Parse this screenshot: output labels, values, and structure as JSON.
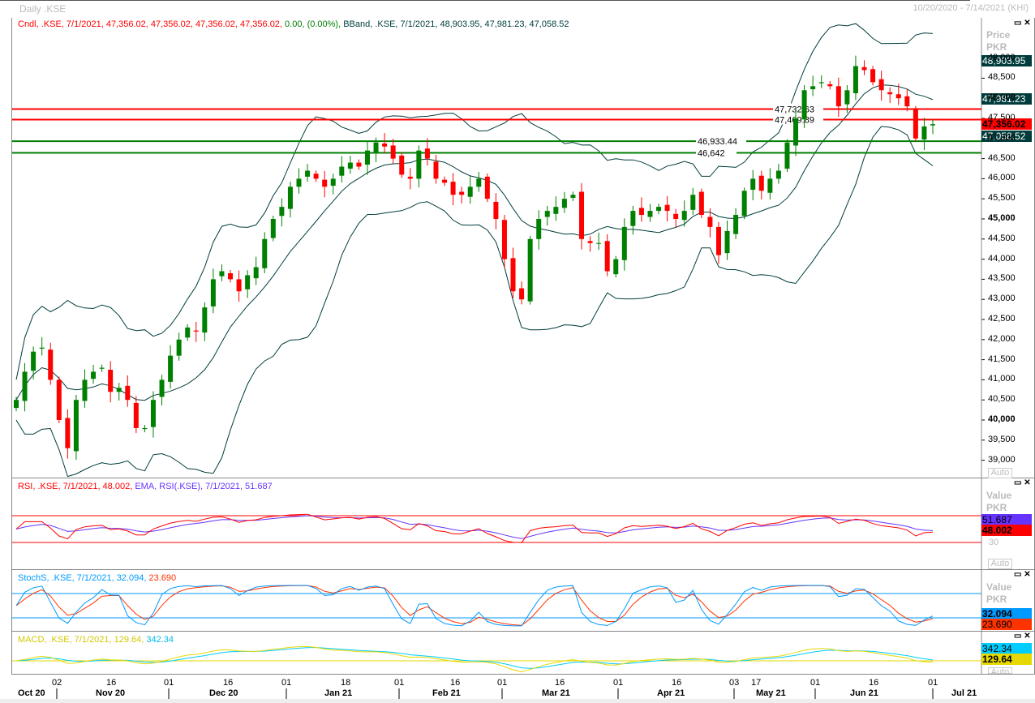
{
  "window": {
    "title": "Daily .KSE",
    "date_range": "10/20/2020 - 7/14/2021 (KHI)"
  },
  "legends": {
    "price_cndl": "Cndl, .KSE, 7/1/2021, 47,356.02, 47,356.02, 47,356.02, 47,356.02,",
    "price_chg": "0.00, (0.00%),",
    "price_bband": "BBand, .KSE, 7/1/2021, 48,903.95, 47,981.23, 47,058.52",
    "rsi": "RSI, .KSE, 7/1/2021, 48.002,",
    "rsi_ema": "EMA, RSI(.KSE), 7/1/2021, 51.687",
    "stoch_a": "StochS, .KSE, 7/1/2021, 32.094,",
    "stoch_b": "23.690",
    "macd_a": "MACD, .KSE, 7/1/2021, 129.64,",
    "macd_b": "342.34"
  },
  "axes": {
    "price_unit_1": "Price",
    "price_unit_2": "PKR",
    "value_unit_1": "Value",
    "value_unit_2": "PKR",
    "auto_label": "Auto",
    "rsi_tick": "30",
    "price_ticks": [
      "49,000",
      "48,500",
      "48,000",
      "47,500",
      "47,000",
      "46,500",
      "46,000",
      "45,500",
      "45,000",
      "44,500",
      "44,000",
      "43,500",
      "43,000",
      "42,500",
      "42,000",
      "41,500",
      "41,000",
      "40,500",
      "40,000",
      "39,500",
      "39,000"
    ],
    "x_days": [
      {
        "label": "02"
      },
      {
        "label": "16"
      },
      {
        "label": "01"
      },
      {
        "label": "16"
      },
      {
        "label": "01"
      },
      {
        "label": "18"
      },
      {
        "label": "01"
      },
      {
        "label": "16"
      },
      {
        "label": "01"
      },
      {
        "label": "16"
      },
      {
        "label": "01"
      },
      {
        "label": "16"
      },
      {
        "label": "03"
      },
      {
        "label": "17"
      },
      {
        "label": "01"
      },
      {
        "label": "16"
      },
      {
        "label": "01"
      }
    ],
    "x_months": [
      "Oct 20",
      "Nov 20",
      "Dec 20",
      "Jan 21",
      "Feb 21",
      "Mar 21",
      "Apr 21",
      "May 21",
      "Jun 21",
      "Jul 21"
    ]
  },
  "tags": {
    "bb_upper": "48,903.95",
    "bb_mid": "47,981.23",
    "last": "47,356.02",
    "bb_lower": "47,058.52",
    "rsi_ema": "51.687",
    "rsi": "48.002",
    "stoch_k": "32.094",
    "stoch_d": "23.690",
    "macd_signal": "342.34",
    "macd": "129.64"
  },
  "colors": {
    "up": "#008000",
    "down": "#ff0000",
    "bband": "#003c3c",
    "rsi": "#ff0000",
    "rsi_ema": "#6633ff",
    "stoch_k": "#0099ff",
    "stoch_d": "#ff3300",
    "macd": "#e6d800",
    "macd_signal": "#00ccff",
    "tag_bband": "#003c3c",
    "tag_last": "#ff0000"
  },
  "chart_data": {
    "type": "candlestick",
    "title": "Daily .KSE",
    "ylabel": "Price PKR",
    "ylim": [
      38500,
      49500
    ],
    "grid": false,
    "close_series": [
      40500,
      41200,
      41700,
      41800,
      41000,
      40000,
      39300,
      40500,
      41000,
      41200,
      41300,
      40700,
      40800,
      40500,
      39800,
      39800,
      40500,
      41000,
      41600,
      42000,
      42300,
      42200,
      42800,
      43500,
      43700,
      43500,
      43200,
      43600,
      43800,
      44500,
      45000,
      45300,
      45800,
      46000,
      46200,
      46000,
      45800,
      46000,
      46300,
      46400,
      46300,
      46700,
      46900,
      46800,
      46500,
      46100,
      46000,
      46700,
      46500,
      46000,
      45900,
      45600,
      45600,
      45800,
      46000,
      45500,
      45000,
      44000,
      43200,
      43000,
      44500,
      45000,
      45200,
      45300,
      45500,
      45600,
      44500,
      44400,
      44400,
      43700,
      44000,
      44800,
      45200,
      45100,
      45200,
      45300,
      45200,
      45000,
      45200,
      45600,
      45100,
      44800,
      44100,
      44700,
      45100,
      45700,
      46000,
      45700,
      46000,
      46200,
      46900,
      47500,
      48200,
      48300,
      48400,
      48300,
      47800,
      48200,
      48800,
      48700,
      48400,
      48200,
      48100,
      48000,
      47800,
      47000,
      47300,
      47356.02
    ],
    "horizontal_levels": [
      {
        "value": 47732.63,
        "label": "47,732.63",
        "color": "#ff0000"
      },
      {
        "value": 47469.89,
        "label": "47,469.89",
        "color": "#ff0000"
      },
      {
        "value": 46933.44,
        "label": "46,933.44",
        "color": "#008000"
      },
      {
        "value": 46642,
        "label": "46,642",
        "color": "#008000"
      }
    ],
    "indicators": {
      "rsi_levels": [
        70,
        30
      ],
      "stoch_levels": [
        80,
        20
      ]
    }
  }
}
